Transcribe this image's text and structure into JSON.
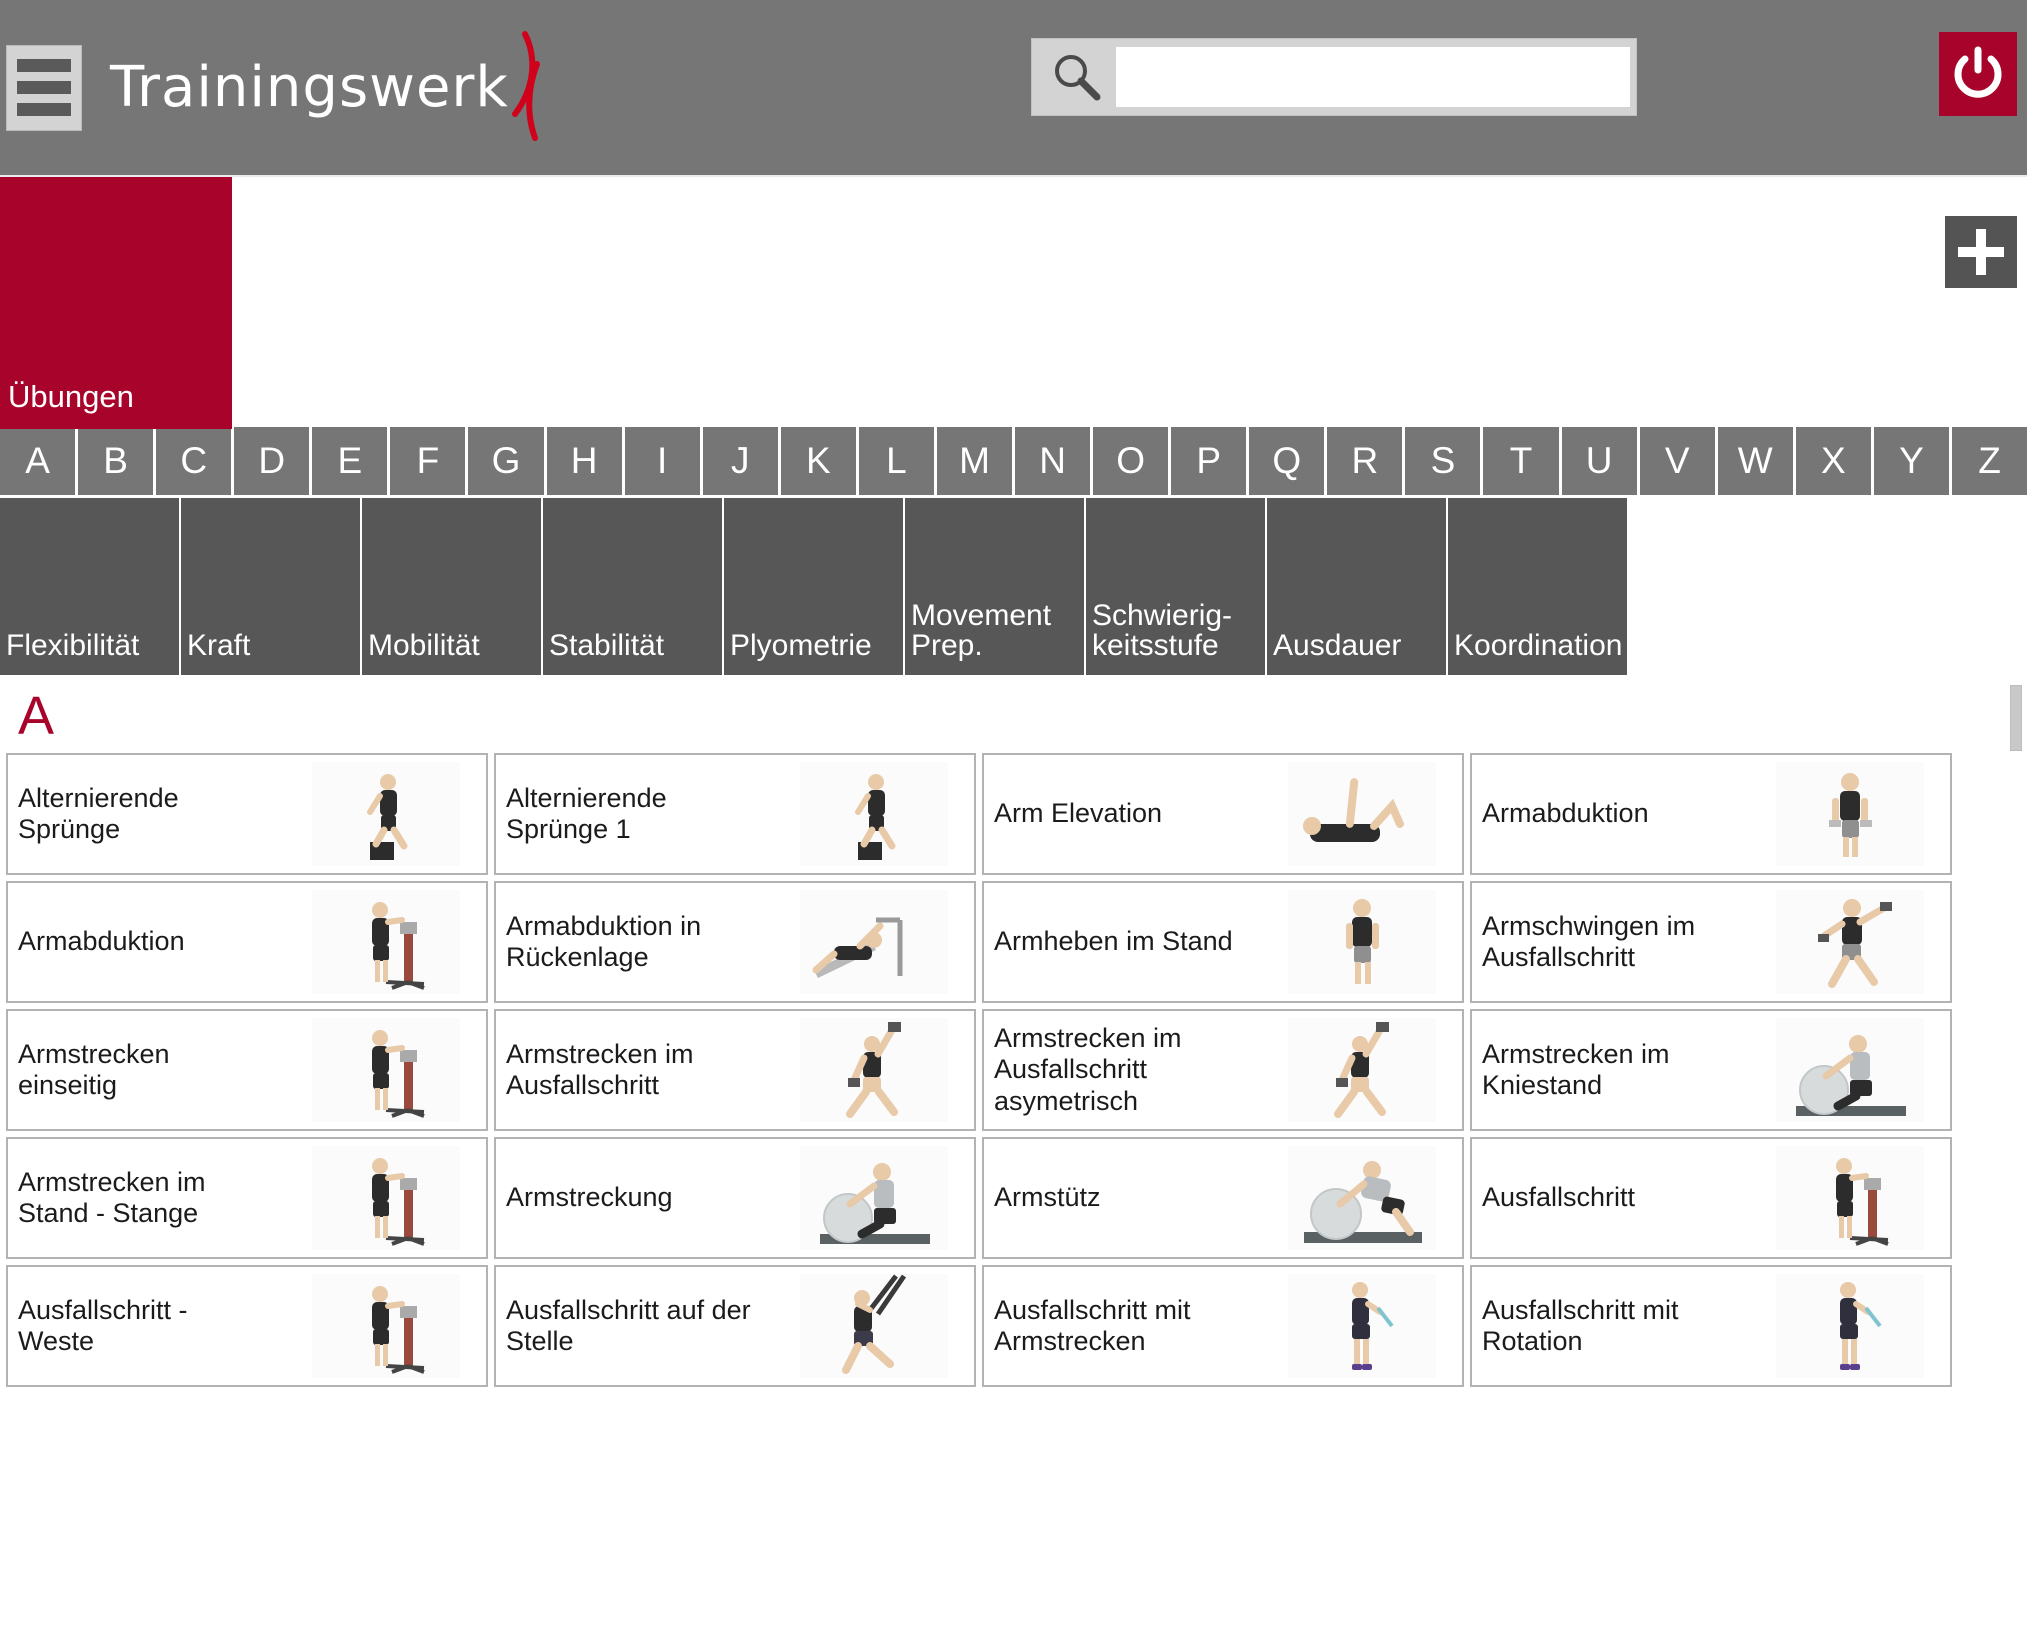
{
  "header": {
    "menu_icon": "hamburger-icon",
    "logo_text": "Trainingswerk",
    "logo_mark": "swoosh-mark",
    "search": {
      "icon": "search-icon",
      "value": "",
      "placeholder": ""
    },
    "power_icon": "power-icon",
    "bar_color": "#767676",
    "accent_color": "#a8042b"
  },
  "tabs": {
    "active_label": "Übungen",
    "add_button_icon": "plus-icon"
  },
  "alphabet": [
    "A",
    "B",
    "C",
    "D",
    "E",
    "F",
    "G",
    "H",
    "I",
    "J",
    "K",
    "L",
    "M",
    "N",
    "O",
    "P",
    "Q",
    "R",
    "S",
    "T",
    "U",
    "V",
    "W",
    "X",
    "Y",
    "Z"
  ],
  "categories": [
    "Flexibilität",
    "Kraft",
    "Mobilität",
    "Stabilität",
    "Plyometrie",
    "Movement\nPrep.",
    "Schwierig-\nkeitsstufe",
    "Ausdauer",
    "Koordination"
  ],
  "section": {
    "letter": "A"
  },
  "exercises": [
    {
      "label": "Alternierende\nSprünge",
      "thumb": "athlete-step-up-box"
    },
    {
      "label": "Alternierende\nSprünge 1",
      "thumb": "athlete-step-up-box"
    },
    {
      "label": "Arm Elevation",
      "thumb": "athlete-supine-leg-raise"
    },
    {
      "label": "Armabduktion",
      "thumb": "athlete-standing-dumbbells"
    },
    {
      "label": "Armabduktion",
      "thumb": "athlete-cable-machine"
    },
    {
      "label": "Armabduktion in\nRückenlage",
      "thumb": "athlete-bench-machine"
    },
    {
      "label": "Armheben im Stand",
      "thumb": "athlete-standing-front"
    },
    {
      "label": "Armschwingen im\nAusfallschritt",
      "thumb": "athlete-lunge-swing"
    },
    {
      "label": "Armstrecken\neinseitig",
      "thumb": "athlete-cable-machine"
    },
    {
      "label": "Armstrecken im\nAusfallschritt",
      "thumb": "athlete-lunge-overhead"
    },
    {
      "label": "Armstrecken im\nAusfallschritt\nasymetrisch",
      "thumb": "athlete-lunge-overhead"
    },
    {
      "label": "Armstrecken im\nKniestand",
      "thumb": "athlete-kneeling-ball"
    },
    {
      "label": "Armstrecken im\nStand - Stange",
      "thumb": "athlete-cable-machine"
    },
    {
      "label": "Armstreckung",
      "thumb": "athlete-kneeling-ball"
    },
    {
      "label": "Armstütz",
      "thumb": "athlete-plank-ball"
    },
    {
      "label": "Ausfallschritt",
      "thumb": "athlete-cable-machine"
    },
    {
      "label": "Ausfallschritt -\nWeste",
      "thumb": "athlete-cable-machine"
    },
    {
      "label": "Ausfallschritt auf der\nStelle",
      "thumb": "athlete-trx-lunge"
    },
    {
      "label": "Ausfallschritt mit\nArmstrecken",
      "thumb": "athlete-standing-band"
    },
    {
      "label": "Ausfallschritt mit\nRotation",
      "thumb": "athlete-standing-band"
    }
  ],
  "scrollbar": {
    "name": "vertical-scrollbar"
  }
}
